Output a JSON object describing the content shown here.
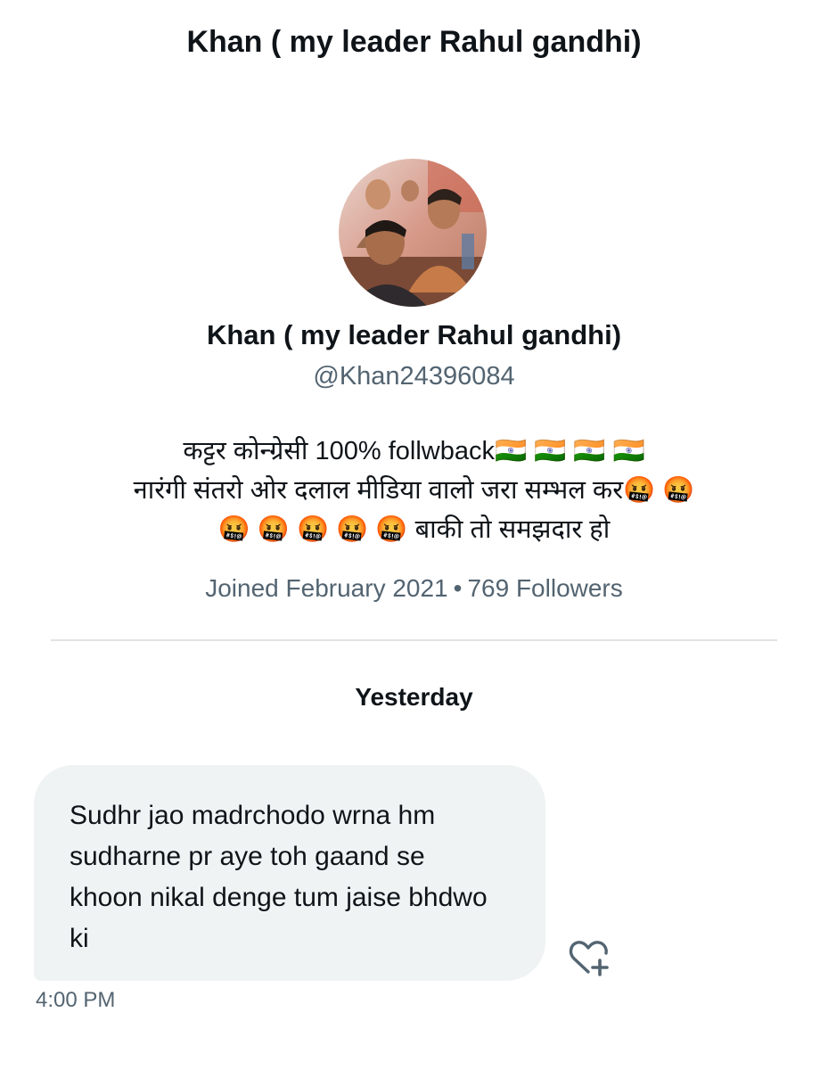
{
  "header": {
    "title": "Khan ( my leader Rahul gandhi)"
  },
  "profile": {
    "name": "Khan ( my leader Rahul gandhi)",
    "handle": "@Khan24396084",
    "bio_lines": [
      "कट्टर कोन्ग्रेसी  100% follwback🇮🇳 🇮🇳 🇮🇳 🇮🇳",
      "नारंगी संतरो ओर दलाल मीडिया वालो जरा सम्भल कर🤬 🤬",
      "🤬 🤬 🤬 🤬 🤬 बाकी तो समझदार हो"
    ],
    "joined": "Joined February 2021",
    "separator": "•",
    "followers": "769 Followers"
  },
  "conversation": {
    "day_label": "Yesterday",
    "message": {
      "text": "Sudhr jao madrchodo wrna hm sudharne pr aye toh gaand se khoon nikal denge tum jaise bhdwo ki",
      "time": "4:00 PM"
    }
  },
  "icons": {
    "avatar": "profile-photo",
    "reaction": "heart-plus-icon"
  },
  "colors": {
    "text": "#0f1419",
    "secondary": "#536471",
    "bubble": "#eff3f4",
    "divider": "#dfe3e6"
  }
}
